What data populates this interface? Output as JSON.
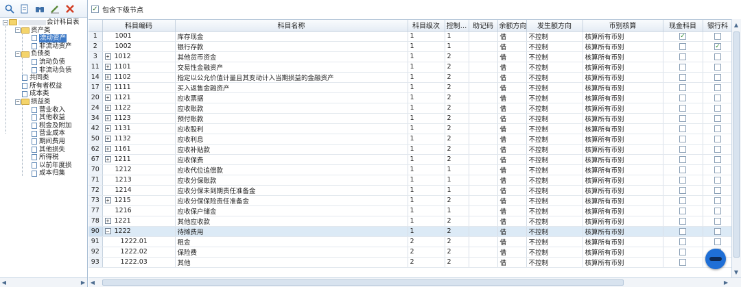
{
  "tree": {
    "root": "会计科目表",
    "nodes": [
      {
        "label": "资产类",
        "type": "folder",
        "level": 1
      },
      {
        "label": "流动资产",
        "type": "doc",
        "level": 2,
        "selected": true
      },
      {
        "label": "非流动资产",
        "type": "doc",
        "level": 2
      },
      {
        "label": "负债类",
        "type": "folder",
        "level": 1
      },
      {
        "label": "流动负债",
        "type": "doc",
        "level": 2
      },
      {
        "label": "非流动负债",
        "type": "doc",
        "level": 2
      },
      {
        "label": "共同类",
        "type": "doc",
        "level": 1
      },
      {
        "label": "所有者权益",
        "type": "doc",
        "level": 1
      },
      {
        "label": "成本类",
        "type": "doc",
        "level": 1
      },
      {
        "label": "损益类",
        "type": "folder",
        "level": 1
      },
      {
        "label": "营业收入",
        "type": "doc",
        "level": 2
      },
      {
        "label": "其他收益",
        "type": "doc",
        "level": 2
      },
      {
        "label": "税金及附加",
        "type": "doc",
        "level": 2
      },
      {
        "label": "营业成本",
        "type": "doc",
        "level": 2
      },
      {
        "label": "期间费用",
        "type": "doc",
        "level": 2
      },
      {
        "label": "其他损失",
        "type": "doc",
        "level": 2
      },
      {
        "label": "所得税",
        "type": "doc",
        "level": 2
      },
      {
        "label": "以前年度损",
        "type": "doc",
        "level": 2
      },
      {
        "label": "成本归集",
        "type": "doc",
        "level": 2
      }
    ]
  },
  "topbar": {
    "include_children_label": "包含下级节点",
    "checked": true
  },
  "columns": [
    "",
    "科目编码",
    "科目名称",
    "科目级次",
    "控制...",
    "助记码",
    "余额方向",
    "发生额方向",
    "币别核算",
    "现金科目",
    "银行科"
  ],
  "rows": [
    {
      "idx": "1",
      "code": "1001",
      "exp": "",
      "name": "库存现金",
      "level": "1",
      "ctrl": "1",
      "mnemonic": "",
      "bal": "借",
      "occ": "不控制",
      "cur": "核算所有币别",
      "cash": true,
      "bank": false
    },
    {
      "idx": "2",
      "code": "1002",
      "exp": "",
      "name": "银行存款",
      "level": "1",
      "ctrl": "1",
      "mnemonic": "",
      "bal": "借",
      "occ": "不控制",
      "cur": "核算所有币别",
      "cash": false,
      "bank": true
    },
    {
      "idx": "3",
      "code": "1012",
      "exp": "+",
      "name": "其他货币资金",
      "level": "1",
      "ctrl": "2",
      "mnemonic": "",
      "bal": "借",
      "occ": "不控制",
      "cur": "核算所有币别",
      "cash": false,
      "bank": false
    },
    {
      "idx": "11",
      "code": "1101",
      "exp": "+",
      "name": "交易性金融资产",
      "level": "1",
      "ctrl": "2",
      "mnemonic": "",
      "bal": "借",
      "occ": "不控制",
      "cur": "核算所有币别",
      "cash": false,
      "bank": false
    },
    {
      "idx": "14",
      "code": "1102",
      "exp": "+",
      "name": "指定以公允价值计量且其变动计入当期损益的金融资产",
      "level": "1",
      "ctrl": "2",
      "mnemonic": "",
      "bal": "借",
      "occ": "不控制",
      "cur": "核算所有币别",
      "cash": false,
      "bank": false
    },
    {
      "idx": "17",
      "code": "1111",
      "exp": "+",
      "name": "买入返售金融资产",
      "level": "1",
      "ctrl": "2",
      "mnemonic": "",
      "bal": "借",
      "occ": "不控制",
      "cur": "核算所有币别",
      "cash": false,
      "bank": false
    },
    {
      "idx": "20",
      "code": "1121",
      "exp": "+",
      "name": "应收票据",
      "level": "1",
      "ctrl": "2",
      "mnemonic": "",
      "bal": "借",
      "occ": "不控制",
      "cur": "核算所有币别",
      "cash": false,
      "bank": false
    },
    {
      "idx": "24",
      "code": "1122",
      "exp": "+",
      "name": "应收账款",
      "level": "1",
      "ctrl": "2",
      "mnemonic": "",
      "bal": "借",
      "occ": "不控制",
      "cur": "核算所有币别",
      "cash": false,
      "bank": false
    },
    {
      "idx": "34",
      "code": "1123",
      "exp": "+",
      "name": "预付账款",
      "level": "1",
      "ctrl": "2",
      "mnemonic": "",
      "bal": "借",
      "occ": "不控制",
      "cur": "核算所有币别",
      "cash": false,
      "bank": false
    },
    {
      "idx": "42",
      "code": "1131",
      "exp": "+",
      "name": "应收股利",
      "level": "1",
      "ctrl": "2",
      "mnemonic": "",
      "bal": "借",
      "occ": "不控制",
      "cur": "核算所有币别",
      "cash": false,
      "bank": false
    },
    {
      "idx": "50",
      "code": "1132",
      "exp": "+",
      "name": "应收利息",
      "level": "1",
      "ctrl": "2",
      "mnemonic": "",
      "bal": "借",
      "occ": "不控制",
      "cur": "核算所有币别",
      "cash": false,
      "bank": false
    },
    {
      "idx": "62",
      "code": "1161",
      "exp": "+",
      "name": "应收补贴款",
      "level": "1",
      "ctrl": "2",
      "mnemonic": "",
      "bal": "借",
      "occ": "不控制",
      "cur": "核算所有币别",
      "cash": false,
      "bank": false
    },
    {
      "idx": "67",
      "code": "1211",
      "exp": "+",
      "name": "应收保费",
      "level": "1",
      "ctrl": "2",
      "mnemonic": "",
      "bal": "借",
      "occ": "不控制",
      "cur": "核算所有币别",
      "cash": false,
      "bank": false
    },
    {
      "idx": "70",
      "code": "1212",
      "exp": "",
      "name": "应收代位追偿款",
      "level": "1",
      "ctrl": "1",
      "mnemonic": "",
      "bal": "借",
      "occ": "不控制",
      "cur": "核算所有币别",
      "cash": false,
      "bank": false
    },
    {
      "idx": "71",
      "code": "1213",
      "exp": "",
      "name": "应收分保账款",
      "level": "1",
      "ctrl": "1",
      "mnemonic": "",
      "bal": "借",
      "occ": "不控制",
      "cur": "核算所有币别",
      "cash": false,
      "bank": false
    },
    {
      "idx": "72",
      "code": "1214",
      "exp": "",
      "name": "应收分保未到期责任准备金",
      "level": "1",
      "ctrl": "1",
      "mnemonic": "",
      "bal": "借",
      "occ": "不控制",
      "cur": "核算所有币别",
      "cash": false,
      "bank": false
    },
    {
      "idx": "73",
      "code": "1215",
      "exp": "+",
      "name": "应收分保保险责任准备金",
      "level": "1",
      "ctrl": "2",
      "mnemonic": "",
      "bal": "借",
      "occ": "不控制",
      "cur": "核算所有币别",
      "cash": false,
      "bank": false
    },
    {
      "idx": "77",
      "code": "1216",
      "exp": "",
      "name": "应收保户储金",
      "level": "1",
      "ctrl": "1",
      "mnemonic": "",
      "bal": "借",
      "occ": "不控制",
      "cur": "核算所有币别",
      "cash": false,
      "bank": false
    },
    {
      "idx": "78",
      "code": "1221",
      "exp": "+",
      "name": "其他应收款",
      "level": "1",
      "ctrl": "2",
      "mnemonic": "",
      "bal": "借",
      "occ": "不控制",
      "cur": "核算所有币别",
      "cash": false,
      "bank": false
    },
    {
      "idx": "90",
      "code": "1222",
      "exp": "−",
      "name": "待摊费用",
      "level": "1",
      "ctrl": "2",
      "mnemonic": "",
      "bal": "借",
      "occ": "不控制",
      "cur": "核算所有币别",
      "cash": false,
      "bank": false,
      "highlight": true
    },
    {
      "idx": "91",
      "code": "1222.01",
      "exp": "",
      "name": "租金",
      "level": "2",
      "ctrl": "2",
      "mnemonic": "",
      "bal": "借",
      "occ": "不控制",
      "cur": "核算所有币别",
      "cash": false,
      "bank": false,
      "indent": true
    },
    {
      "idx": "92",
      "code": "1222.02",
      "exp": "",
      "name": "保险费",
      "level": "2",
      "ctrl": "2",
      "mnemonic": "",
      "bal": "借",
      "occ": "不控制",
      "cur": "核算所有币别",
      "cash": false,
      "bank": false,
      "indent": true
    },
    {
      "idx": "93",
      "code": "1222.03",
      "exp": "",
      "name": "其他",
      "level": "2",
      "ctrl": "2",
      "mnemonic": "",
      "bal": "借",
      "occ": "不控制",
      "cur": "核算所有币别",
      "cash": false,
      "bank": false,
      "indent": true
    }
  ]
}
